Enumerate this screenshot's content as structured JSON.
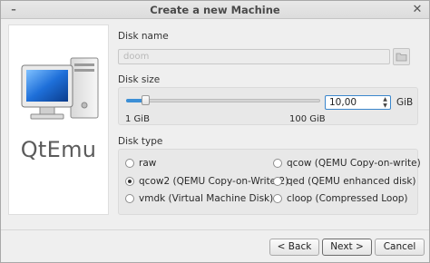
{
  "window": {
    "title": "Create a new Machine",
    "minimize_icon": "minimize-icon",
    "close_icon": "close-icon"
  },
  "sidebar": {
    "brand": "QtEmu",
    "graphic_icon": "computer-tower-icon"
  },
  "disk_name": {
    "label": "Disk name",
    "value": "doom",
    "browse_icon": "folder-icon"
  },
  "disk_size": {
    "label": "Disk size",
    "slider_fraction": 0.1,
    "value": "10,00",
    "unit": "GiB",
    "min_label": "1 GiB",
    "max_label": "100 GiB"
  },
  "disk_type": {
    "label": "Disk type",
    "options": [
      {
        "label": "raw",
        "selected": false
      },
      {
        "label": "qcow (QEMU Copy-on-write)",
        "selected": false
      },
      {
        "label": "qcow2 (QEMU Copy-on-Write 2)",
        "selected": true
      },
      {
        "label": "qed (QEMU enhanced disk)",
        "selected": false
      },
      {
        "label": "vmdk (Virtual Machine Disk)",
        "selected": false
      },
      {
        "label": "cloop (Compressed Loop)",
        "selected": false
      }
    ]
  },
  "buttons": {
    "back": "< Back",
    "next": "Next >",
    "cancel": "Cancel"
  },
  "colors": {
    "accent": "#3c8fd6"
  }
}
